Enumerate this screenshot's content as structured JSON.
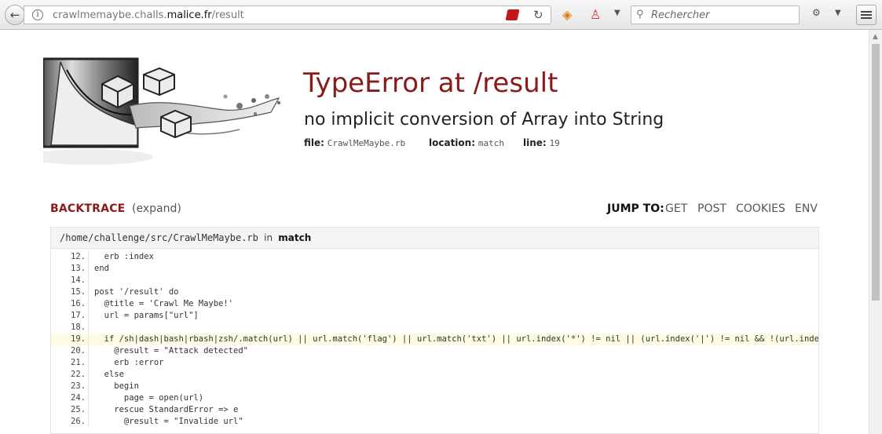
{
  "browser": {
    "url_prefix": "crawlmemaybe.challs.",
    "url_domain": "malice.fr",
    "url_path": "/result",
    "search_placeholder": "Rechercher"
  },
  "error": {
    "title": "TypeError at /result",
    "message": "no implicit conversion of Array into String",
    "file_label": "file:",
    "file_value": "CrawlMeMaybe.rb",
    "location_label": "location:",
    "location_value": "match",
    "line_label": "line:",
    "line_value": "19"
  },
  "backtrace": {
    "title": "BACKTRACE",
    "expand": "(expand)",
    "jump_label": "JUMP TO:",
    "jump_links": [
      "GET",
      "POST",
      "COOKIES",
      "ENV"
    ],
    "frame_path": "/home/challenge/src/CrawlMeMaybe.rb",
    "frame_in": "in",
    "frame_function": "match",
    "highlight_line": "19.",
    "lines": [
      {
        "n": "12.",
        "code": "  erb :index"
      },
      {
        "n": "13.",
        "code": "end"
      },
      {
        "n": "14.",
        "code": ""
      },
      {
        "n": "15.",
        "code": "post '/result' do"
      },
      {
        "n": "16.",
        "code": "  @title = 'Crawl Me Maybe!'"
      },
      {
        "n": "17.",
        "code": "  url = params[\"url\"]"
      },
      {
        "n": "18.",
        "code": ""
      },
      {
        "n": "19.",
        "code": "  if /sh|dash|bash|rbash|zsh/.match(url) || url.match('flag') || url.match('txt') || url.index('*') != nil || (url.index('|') != nil && !(url.index('cat') != nil ||"
      },
      {
        "n": "20.",
        "code": "    @result = \"Attack detected\""
      },
      {
        "n": "21.",
        "code": "    erb :error"
      },
      {
        "n": "22.",
        "code": "  else"
      },
      {
        "n": "23.",
        "code": "    begin"
      },
      {
        "n": "24.",
        "code": "      page = open(url)"
      },
      {
        "n": "25.",
        "code": "    rescue StandardError => e"
      },
      {
        "n": "26.",
        "code": "      @result = \"Invalide url\""
      }
    ]
  },
  "colors": {
    "accent": "#8a1a1a",
    "highlight": "#fdfbe1"
  }
}
